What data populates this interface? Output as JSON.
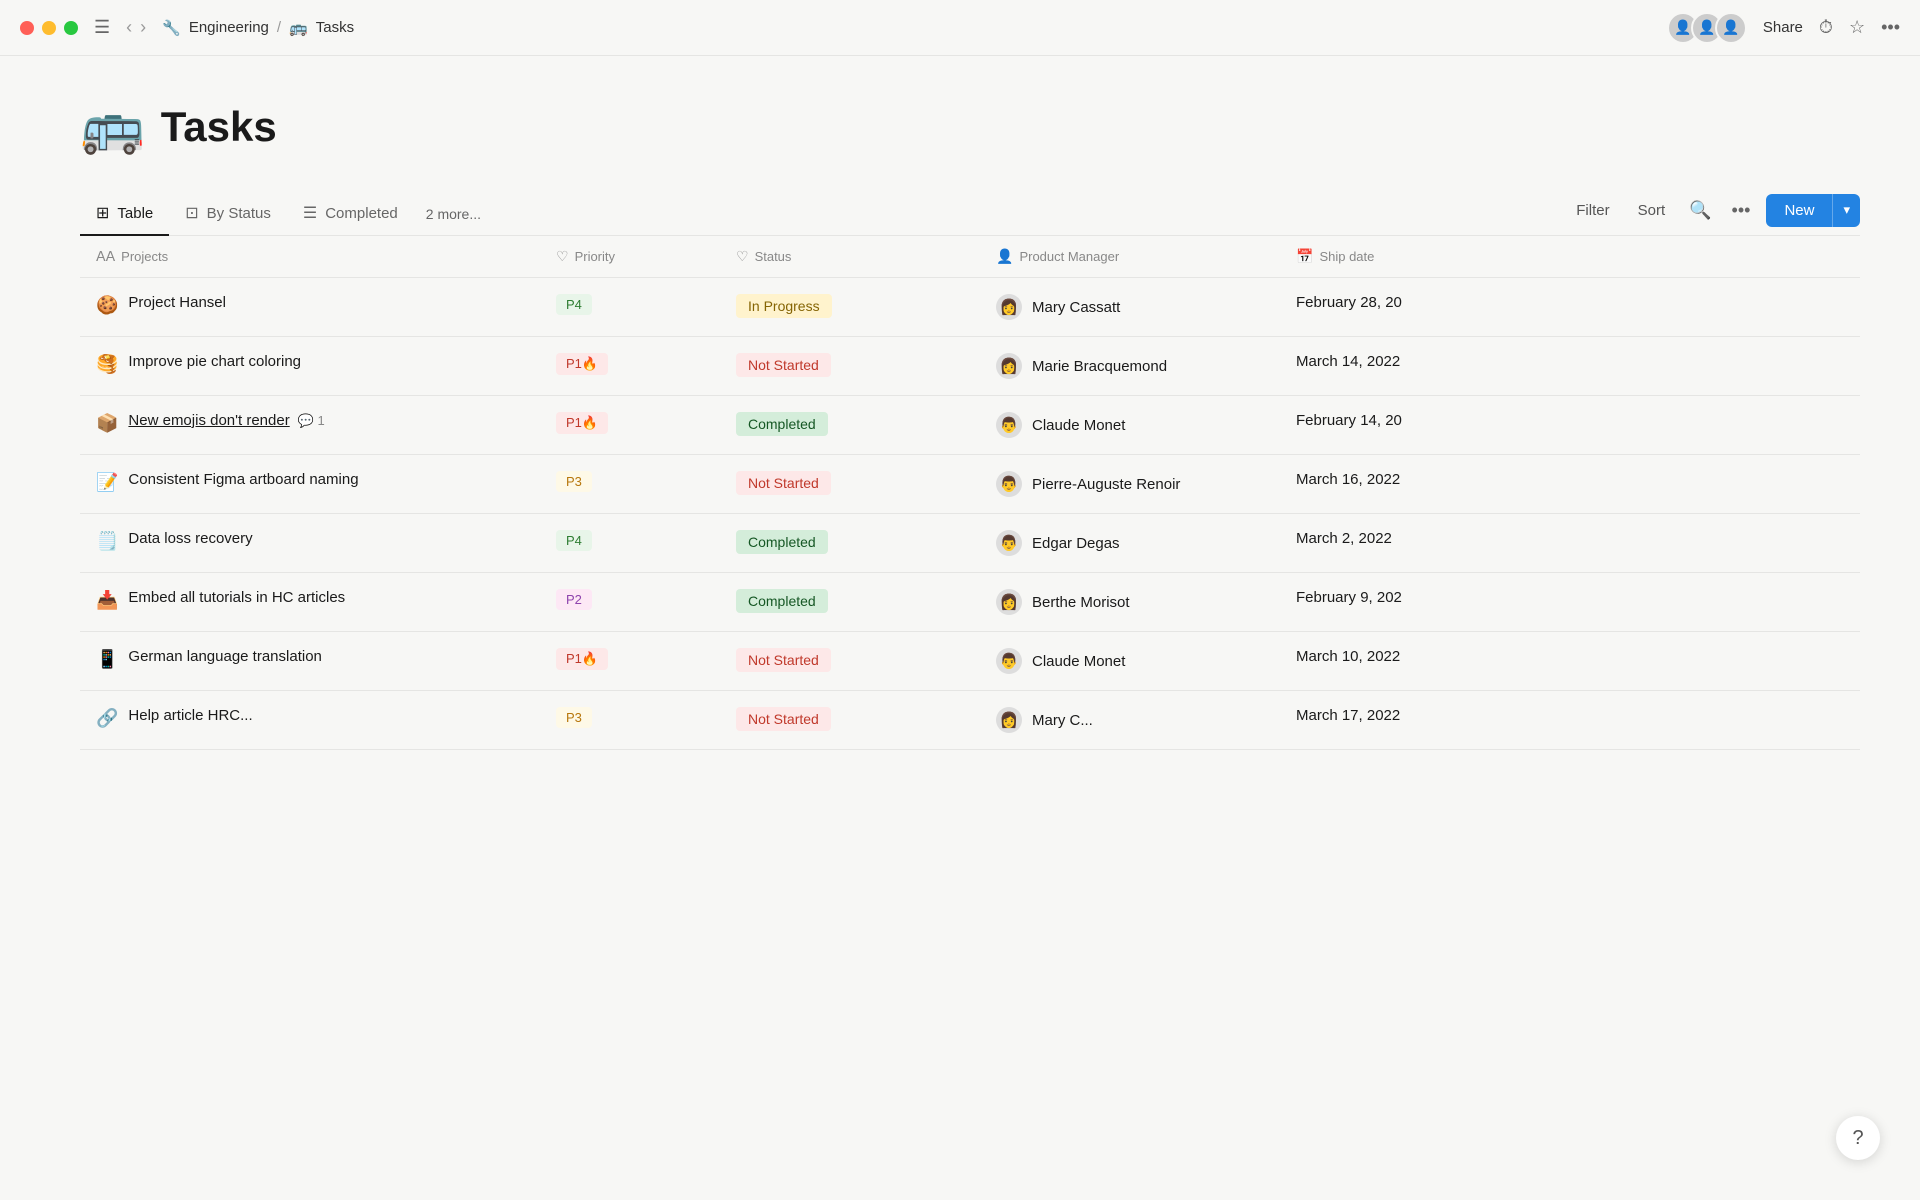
{
  "titlebar": {
    "breadcrumb_workspace": "Engineering",
    "breadcrumb_sep": "/",
    "breadcrumb_page": "Tasks",
    "share_label": "Share"
  },
  "page": {
    "emoji": "🚌",
    "title": "Tasks"
  },
  "tabs": [
    {
      "id": "table",
      "icon": "⊞",
      "label": "Table",
      "active": true
    },
    {
      "id": "by-status",
      "icon": "⊡",
      "label": "By Status",
      "active": false
    },
    {
      "id": "completed",
      "icon": "☰",
      "label": "Completed",
      "active": false
    }
  ],
  "more_tabs_label": "2 more...",
  "actions": {
    "filter_label": "Filter",
    "sort_label": "Sort",
    "new_label": "New"
  },
  "columns": [
    {
      "id": "projects",
      "icon": "𝖠𝖠",
      "label": "Projects"
    },
    {
      "id": "priority",
      "icon": "♡",
      "label": "Priority"
    },
    {
      "id": "status",
      "icon": "♡",
      "label": "Status"
    },
    {
      "id": "pm",
      "icon": "👤",
      "label": "Product Manager"
    },
    {
      "id": "ship",
      "icon": "📅",
      "label": "Ship date"
    }
  ],
  "rows": [
    {
      "id": 1,
      "emoji": "🍪",
      "name": "Project Hansel",
      "has_link": false,
      "comment_count": null,
      "priority": "P4",
      "priority_level": "p4",
      "status": "In Progress",
      "status_key": "in-progress",
      "pm_emoji": "👩",
      "pm_name": "Mary Cassatt",
      "ship_date": "February 28, 20"
    },
    {
      "id": 2,
      "emoji": "🥞",
      "name": "Improve pie chart coloring",
      "has_link": false,
      "comment_count": null,
      "priority": "P1🔥",
      "priority_level": "p1",
      "status": "Not Started",
      "status_key": "not-started",
      "pm_emoji": "👩",
      "pm_name": "Marie Bracquemond",
      "ship_date": "March 14, 2022"
    },
    {
      "id": 3,
      "emoji": "📦",
      "name": "New emojis don't render",
      "has_link": true,
      "comment_count": 1,
      "priority": "P1🔥",
      "priority_level": "p1",
      "status": "Completed",
      "status_key": "completed",
      "pm_emoji": "👨",
      "pm_name": "Claude Monet",
      "ship_date": "February 14, 20"
    },
    {
      "id": 4,
      "emoji": "📝",
      "name": "Consistent Figma artboard naming",
      "has_link": false,
      "comment_count": null,
      "priority": "P3",
      "priority_level": "p3",
      "status": "Not Started",
      "status_key": "not-started",
      "pm_emoji": "👨",
      "pm_name": "Pierre-Auguste Renoir",
      "ship_date": "March 16, 2022"
    },
    {
      "id": 5,
      "emoji": "🗒️",
      "name": "Data loss recovery",
      "has_link": false,
      "comment_count": null,
      "priority": "P4",
      "priority_level": "p4",
      "status": "Completed",
      "status_key": "completed",
      "pm_emoji": "👨",
      "pm_name": "Edgar Degas",
      "ship_date": "March 2, 2022"
    },
    {
      "id": 6,
      "emoji": "📥",
      "name": "Embed all tutorials in HC articles",
      "has_link": false,
      "comment_count": null,
      "priority": "P2",
      "priority_level": "p2",
      "status": "Completed",
      "status_key": "completed",
      "pm_emoji": "👩",
      "pm_name": "Berthe Morisot",
      "ship_date": "February 9, 202"
    },
    {
      "id": 7,
      "emoji": "📱",
      "name": "German language translation",
      "has_link": false,
      "comment_count": null,
      "priority": "P1🔥",
      "priority_level": "p1",
      "status": "Not Started",
      "status_key": "not-started",
      "pm_emoji": "👨",
      "pm_name": "Claude Monet",
      "ship_date": "March 10, 2022"
    },
    {
      "id": 8,
      "emoji": "🔗",
      "name": "Help article HRC...",
      "has_link": false,
      "comment_count": null,
      "priority": "P3",
      "priority_level": "p3",
      "status": "Not Started",
      "status_key": "not-started",
      "pm_emoji": "👩",
      "pm_name": "Mary C...",
      "ship_date": "March 17, 2022"
    }
  ],
  "help_icon": "?"
}
